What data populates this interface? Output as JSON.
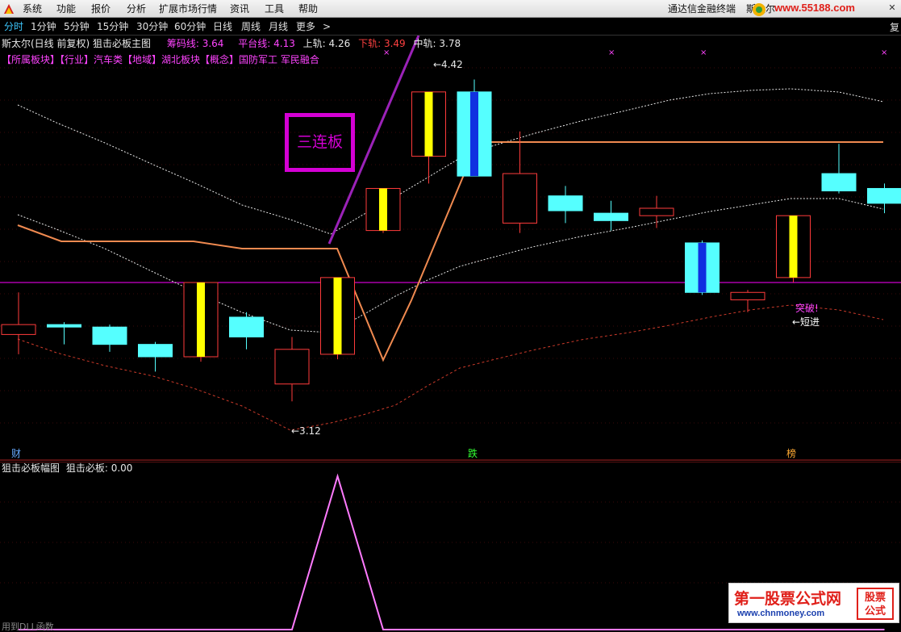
{
  "menubar": {
    "items": [
      "系统",
      "功能",
      "报价",
      "分析",
      "扩展市场行情",
      "资讯",
      "工具",
      "帮助"
    ],
    "terminal_name": "通达信金融终端",
    "stock_name": "斯太尔",
    "watermark_url": "www.55188.com"
  },
  "period_bar": {
    "items": [
      "分时",
      "1分钟",
      "5分钟",
      "15分钟",
      "30分钟",
      "60分钟",
      "日线",
      "周线",
      "月线",
      "更多",
      ">"
    ],
    "active": "分时",
    "right_label": "复"
  },
  "info_line": {
    "title": "斯太尔(日线 前复权) 狙击必板主图",
    "items": [
      {
        "label": "筹码线:",
        "value": "3.64",
        "color": "#ff44ff"
      },
      {
        "label": "平台线:",
        "value": "4.13",
        "color": "#ff44ff"
      },
      {
        "label": "上轨:",
        "value": "4.26",
        "color": "#e8e8e8"
      },
      {
        "label": "下轨:",
        "value": "3.49",
        "color": "#ff4040"
      },
      {
        "label": "中轨:",
        "value": "3.78",
        "color": "#e8e8e8"
      }
    ]
  },
  "sector_line": "【所属板块】【行业】汽车类【地域】湖北板块【概念】国防军工 军民融合",
  "annotation": {
    "text": "三连板",
    "color": "#d400d4"
  },
  "signals": {
    "cai": "财",
    "die": "跌",
    "bang": "榜",
    "breakout": "突破!",
    "short_entry": "←短进",
    "low_label": "←3.12",
    "high_label": "←4.42"
  },
  "sub_chart": {
    "title": "狙击必板幅图",
    "indicator": "狙击必板: 0.00"
  },
  "status_bar": "用到DLL函数",
  "watermark": {
    "title": "第一股票公式网",
    "url": "www.chnmoney.com",
    "badge": [
      "股票",
      "公式"
    ]
  },
  "colors": {
    "up": "#ff3b3b",
    "down": "#55ffff",
    "limit_up_fill": "#ffff00",
    "blue_inner": "#1030e0",
    "platform_line": "#f08a50",
    "chip_line": "#cc3a2a",
    "mid_line": "#ff00ff",
    "band": "#e8e8e8"
  },
  "chart_data": {
    "type": "candlestick",
    "price_range": [
      3.0,
      4.5
    ],
    "candles": [
      {
        "open": 3.39,
        "close": 3.43,
        "high": 3.56,
        "low": 3.31,
        "dir": "up"
      },
      {
        "open": 3.43,
        "close": 3.42,
        "high": 3.44,
        "low": 3.35,
        "dir": "down"
      },
      {
        "open": 3.42,
        "close": 3.35,
        "high": 3.43,
        "low": 3.32,
        "dir": "down"
      },
      {
        "open": 3.35,
        "close": 3.3,
        "high": 3.36,
        "low": 3.24,
        "dir": "down"
      },
      {
        "open": 3.3,
        "close": 3.6,
        "high": 3.6,
        "low": 3.28,
        "dir": "up",
        "limit_up": true
      },
      {
        "open": 3.46,
        "close": 3.38,
        "high": 3.48,
        "low": 3.33,
        "dir": "down"
      },
      {
        "open": 3.19,
        "close": 3.33,
        "high": 3.38,
        "low": 3.12,
        "dir": "up"
      },
      {
        "open": 3.31,
        "close": 3.62,
        "high": 3.62,
        "low": 3.29,
        "dir": "up",
        "limit_up": true
      },
      {
        "open": 3.81,
        "close": 3.98,
        "high": 3.98,
        "low": 3.8,
        "dir": "up",
        "limit_up": true
      },
      {
        "open": 4.11,
        "close": 4.37,
        "high": 4.37,
        "low": 4.0,
        "dir": "up",
        "limit_up": true
      },
      {
        "open": 4.37,
        "close": 4.03,
        "high": 4.42,
        "low": 4.03,
        "dir": "down",
        "limit_down": true
      },
      {
        "open": 3.84,
        "close": 4.04,
        "high": 4.21,
        "low": 3.8,
        "dir": "up"
      },
      {
        "open": 3.95,
        "close": 3.89,
        "high": 3.99,
        "low": 3.84,
        "dir": "down"
      },
      {
        "open": 3.88,
        "close": 3.85,
        "high": 3.93,
        "low": 3.81,
        "dir": "down"
      },
      {
        "open": 3.87,
        "close": 3.9,
        "high": 3.95,
        "low": 3.82,
        "dir": "up"
      },
      {
        "open": 3.76,
        "close": 3.56,
        "high": 3.77,
        "low": 3.55,
        "dir": "down",
        "limit_down": true
      },
      {
        "open": 3.53,
        "close": 3.56,
        "high": 3.57,
        "low": 3.48,
        "dir": "up"
      },
      {
        "open": 3.62,
        "close": 3.87,
        "high": 3.87,
        "low": 3.6,
        "dir": "up",
        "limit_up": true
      },
      {
        "open": 4.04,
        "close": 3.97,
        "high": 4.16,
        "low": 3.96,
        "dir": "down"
      },
      {
        "open": 3.98,
        "close": 3.92,
        "high": 4.0,
        "low": 3.88,
        "dir": "down"
      }
    ],
    "mid_line_value": 3.64,
    "sub_indicator": {
      "name": "狙击必板",
      "values": [
        0,
        0,
        0,
        0,
        0,
        0,
        0,
        1,
        0,
        0,
        0,
        0,
        0,
        0,
        0,
        0,
        0,
        0,
        0,
        0
      ]
    }
  }
}
